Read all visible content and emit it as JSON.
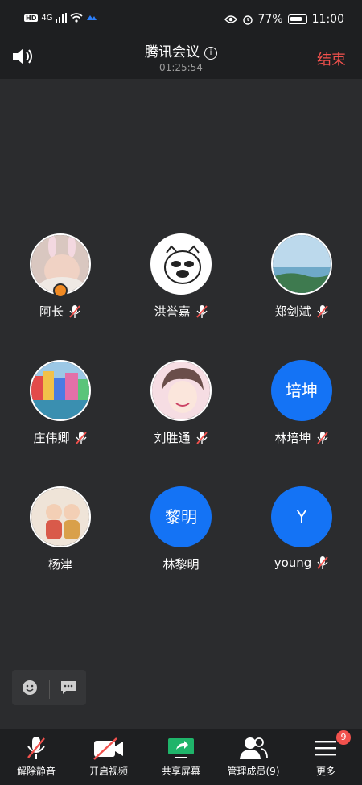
{
  "statusbar": {
    "signal": "4G",
    "battery": "77%",
    "time": "11:00"
  },
  "meeting": {
    "title": "腾讯会议",
    "timer": "01:25:54",
    "end_label": "结束",
    "info_icon": "i"
  },
  "participants": [
    {
      "name": "阿长",
      "initials": "",
      "muted": true,
      "host": true,
      "avatar": "baby-photo"
    },
    {
      "name": "洪誉嘉",
      "initials": "",
      "muted": true,
      "avatar": "cartoon-pig"
    },
    {
      "name": "郑剑斌",
      "initials": "",
      "muted": true,
      "avatar": "seaside-photo"
    },
    {
      "name": "庄伟卿",
      "initials": "",
      "muted": true,
      "avatar": "colorful-houses"
    },
    {
      "name": "刘胜通",
      "initials": "",
      "muted": true,
      "avatar": "anime-boy"
    },
    {
      "name": "林培坤",
      "initials": "培坤",
      "muted": true,
      "avatar": "initials"
    },
    {
      "name": "杨津",
      "initials": "",
      "muted": false,
      "avatar": "cartoon-couple"
    },
    {
      "name": "林黎明",
      "initials": "黎明",
      "muted": false,
      "avatar": "initials"
    },
    {
      "name": "young",
      "initials": "Y",
      "muted": true,
      "avatar": "initials"
    }
  ],
  "toolbar": {
    "unmute": "解除静音",
    "video": "开启视频",
    "share": "共享屏幕",
    "members": "管理成员(9)",
    "more": "更多",
    "more_badge": "9"
  },
  "colors": {
    "accent_blue": "#1473f5",
    "end_red": "#f2514d",
    "share_green": "#1fb46a"
  }
}
